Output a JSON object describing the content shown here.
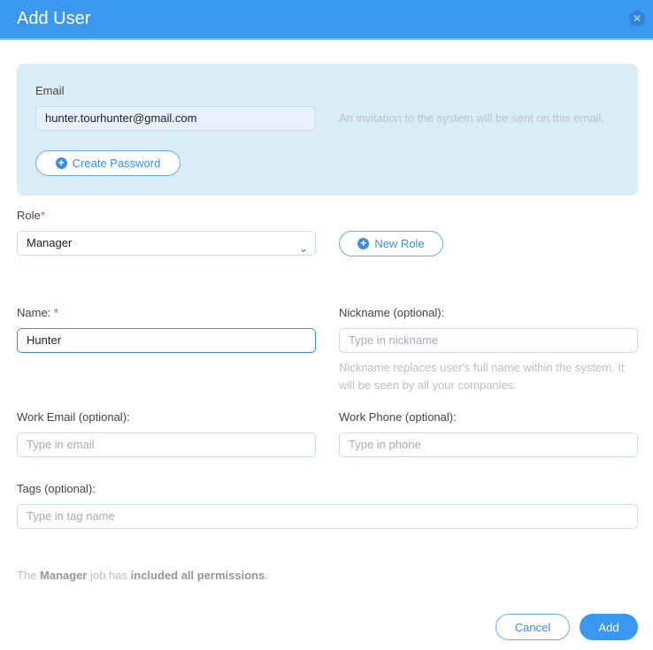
{
  "dialog": {
    "title": "Add User",
    "close_icon": "close-icon"
  },
  "email": {
    "label": "Email",
    "value": "hunter.tourhunter@gmail.com",
    "hint": "An invitation to the system will be sent on this email.",
    "create_password_label": "Create Password"
  },
  "role": {
    "label": "Role",
    "required": "*",
    "value": "Manager",
    "new_role_label": "New Role"
  },
  "name": {
    "label": "Name:",
    "required": "*",
    "value": "Hunter"
  },
  "nickname": {
    "label": "Nickname (optional):",
    "placeholder": "Type in nickname",
    "hint_line1": "Nickname replaces user's full name within the system. It",
    "hint_line2": "will be seen by all your companies."
  },
  "work_email": {
    "label": "Work Email (optional):",
    "placeholder": "Type in email"
  },
  "work_phone": {
    "label": "Work Phone (optional):",
    "placeholder": "Type in phone"
  },
  "tags": {
    "label": "Tags (optional):",
    "placeholder": "Type in tag name"
  },
  "note": {
    "p1": "The ",
    "role": "Manager",
    "p2": " job has ",
    "perm": "included all permissions",
    "p3": "."
  },
  "footer": {
    "cancel_label": "Cancel",
    "add_label": "Add"
  },
  "colors": {
    "accent": "#3a99ee",
    "info_box": "#d9edf7"
  }
}
